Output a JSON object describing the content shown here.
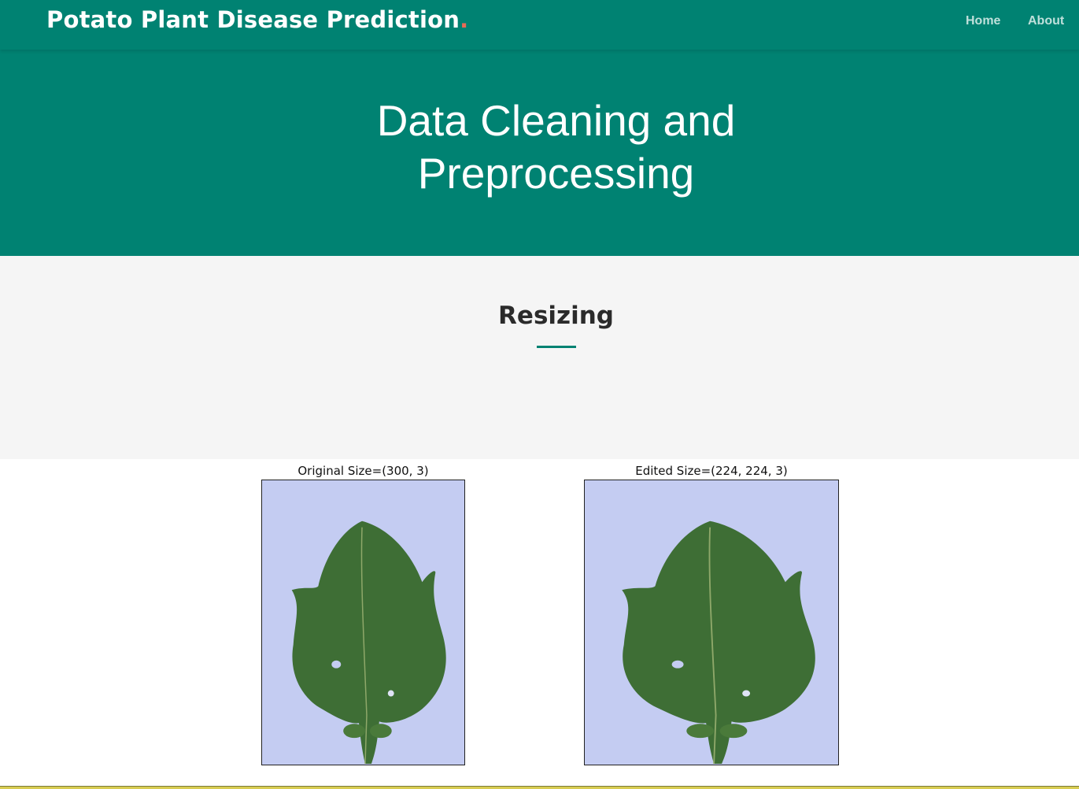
{
  "navbar": {
    "brand": "Potato Plant Disease Prediction",
    "brand_dot": ".",
    "links": [
      {
        "label": "Home"
      },
      {
        "label": "About"
      }
    ]
  },
  "hero": {
    "title": "Data Cleaning and Preprocessing"
  },
  "section": {
    "title": "Resizing"
  },
  "figure": {
    "panels": [
      {
        "caption": "Original Size=(300, 3)"
      },
      {
        "caption": "Edited Size=(224, 224, 3)"
      }
    ]
  },
  "colors": {
    "primary": "#008272",
    "accent_dot": "#e96b56",
    "section_bg": "#f5f5f5",
    "image_bg": "#c4ccf2",
    "leaf": "#3e6e35"
  }
}
